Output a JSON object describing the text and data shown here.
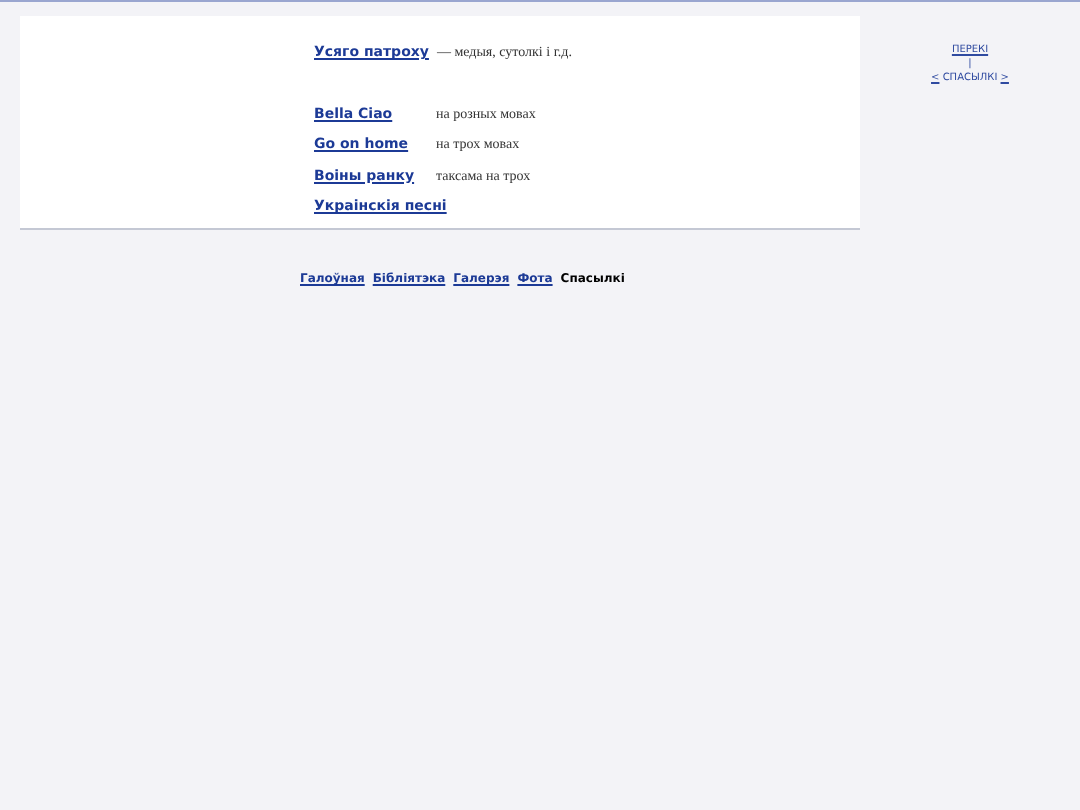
{
  "entries": [
    {
      "title": "Усяго патроху",
      "description": "— медыя, сутолкі і г.д."
    },
    {
      "title": "Bella Ciao",
      "description": "на розных мовах"
    },
    {
      "title": "Go on home",
      "description": "на трох мовах"
    },
    {
      "title": "Воіны ранку",
      "description": "таксама на трох"
    },
    {
      "title": "Украінскія песні"
    }
  ],
  "side_nav": {
    "top": "ПЕРЕКІ",
    "separator": "|",
    "prev": "<",
    "label": "СПАСЫЛКІ",
    "next": ">"
  },
  "footer_nav": [
    {
      "label": "Галоўная",
      "selected": false
    },
    {
      "label": "Бібліятэка",
      "selected": false
    },
    {
      "label": "Галерэя",
      "selected": false
    },
    {
      "label": "Фота",
      "selected": false
    },
    {
      "label": "Спасылкі",
      "selected": true
    }
  ]
}
